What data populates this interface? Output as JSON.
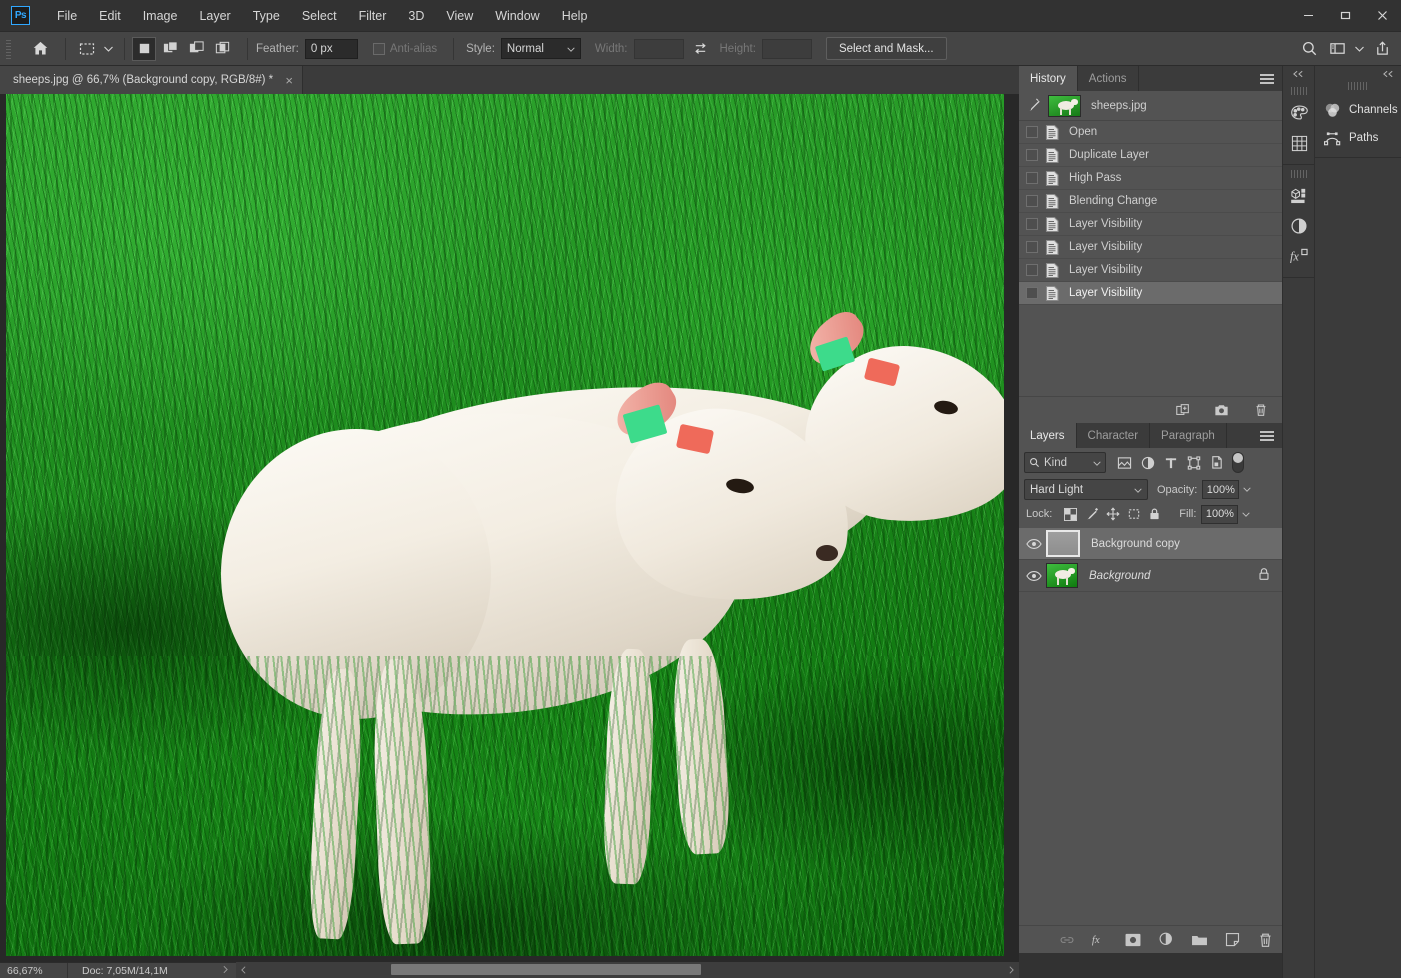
{
  "app": {
    "logo": "Ps",
    "menus": [
      "File",
      "Edit",
      "Image",
      "Layer",
      "Type",
      "Select",
      "Filter",
      "3D",
      "View",
      "Window",
      "Help"
    ],
    "window_controls": {
      "minimize": "minimize-icon",
      "maximize": "maximize-icon",
      "close": "close-icon"
    }
  },
  "options_bar": {
    "home_icon": "home-icon",
    "tool_icon": "rectangular-marquee-icon",
    "tool_caret": "chevron-down-icon",
    "selection_modes": [
      {
        "name": "new-selection",
        "active": true
      },
      {
        "name": "add-to-selection",
        "active": false
      },
      {
        "name": "subtract-from-selection",
        "active": false
      },
      {
        "name": "intersect-with-selection",
        "active": false
      }
    ],
    "feather_label": "Feather:",
    "feather_value": "0 px",
    "antialias_label": "Anti-alias",
    "antialias_checked": false,
    "style_label": "Style:",
    "style_value": "Normal",
    "width_label": "Width:",
    "width_value": "",
    "swap_icon": "swap-width-height-icon",
    "height_label": "Height:",
    "height_value": "",
    "select_and_mask": "Select and Mask...",
    "right_icons": [
      "search-icon",
      "workspace-icon",
      "chevron-down-icon",
      "share-icon"
    ]
  },
  "document": {
    "tab_title": "sheeps.jpg @ 66,7% (Background copy, RGB/8#) *",
    "close_icon": "close-icon"
  },
  "canvas": {
    "image_description": "two white lambs standing in bright green grass",
    "vscroll": {
      "up": "chevron-up-icon",
      "down": "chevron-down-icon"
    },
    "hscroll": {
      "left": "chevron-left-icon",
      "right": "chevron-right-icon"
    }
  },
  "status_bar": {
    "zoom": "66,67%",
    "doc_label": "Doc: 7,05M/14,1M",
    "expand_icon": "chevron-right-icon",
    "collapse_icon": "chevron-left-icon"
  },
  "history_panel": {
    "tabs": [
      {
        "label": "History",
        "active": true
      },
      {
        "label": "Actions",
        "active": false
      }
    ],
    "menu_icon": "panel-menu-icon",
    "snapshot": {
      "label": "sheeps.jpg",
      "brush_icon": "history-brush-icon"
    },
    "states": [
      {
        "label": "Open",
        "selected": false
      },
      {
        "label": "Duplicate Layer",
        "selected": false
      },
      {
        "label": "High Pass",
        "selected": false
      },
      {
        "label": "Blending Change",
        "selected": false
      },
      {
        "label": "Layer Visibility",
        "selected": false
      },
      {
        "label": "Layer Visibility",
        "selected": false
      },
      {
        "label": "Layer Visibility",
        "selected": false
      },
      {
        "label": "Layer Visibility",
        "selected": true
      }
    ],
    "footer_icons": [
      "create-document-from-state-icon",
      "create-snapshot-icon",
      "delete-state-icon"
    ]
  },
  "layers_panel": {
    "tabs": [
      {
        "label": "Layers",
        "active": true
      },
      {
        "label": "Character",
        "active": false
      },
      {
        "label": "Paragraph",
        "active": false
      }
    ],
    "menu_icon": "panel-menu-icon",
    "filter": {
      "kind_label": "Kind",
      "search_icon": "search-icon",
      "caret_icon": "chevron-down-icon",
      "type_filters": [
        "pixel-layer-filter-icon",
        "adjustment-layer-filter-icon",
        "type-layer-filter-icon",
        "shape-layer-filter-icon",
        "smart-object-filter-icon"
      ],
      "toggle_icon": "filter-toggle-switch"
    },
    "blend_mode": "Hard Light",
    "opacity_label": "Opacity:",
    "opacity_value": "100%",
    "lock_label": "Lock:",
    "lock_icons": [
      "lock-transparent-pixels-icon",
      "lock-image-pixels-icon",
      "lock-position-icon",
      "lock-artboard-nesting-icon",
      "lock-all-icon"
    ],
    "fill_label": "Fill:",
    "fill_value": "100%",
    "layers": [
      {
        "name": "Background copy",
        "visible": true,
        "selected": true,
        "italic": false,
        "locked": false,
        "thumb": "gray-highpass-thumb"
      },
      {
        "name": "Background",
        "visible": true,
        "selected": false,
        "italic": true,
        "locked": true,
        "thumb": "sheep-photo-thumb"
      }
    ],
    "footer_icons": [
      "link-layers-icon",
      "add-layer-style-icon",
      "add-layer-mask-icon",
      "new-adjustment-layer-icon",
      "new-group-icon",
      "new-layer-icon",
      "delete-layer-icon"
    ]
  },
  "icon_rail": {
    "collapse_icon": "double-chevron-left-icon",
    "groups": [
      [
        "color-swatches-icon",
        "swatches-grid-icon"
      ],
      [
        "3d-panel-icon",
        "adjustments-icon",
        "layer-styles-fx-icon"
      ]
    ]
  },
  "channels_paths_panel": {
    "collapse_icon": "double-chevron-left-icon",
    "items": [
      {
        "label": "Channels",
        "icon": "channels-icon"
      },
      {
        "label": "Paths",
        "icon": "paths-icon"
      }
    ]
  },
  "colors": {
    "app_bg": "#323232",
    "options_bar": "#454545",
    "panel_bg": "#535353",
    "tab_inactive": "#3b3b3b",
    "selection_highlight": "#6b6b6b",
    "text": "#d6d6d6",
    "accent_blue": "#31a8ff",
    "grass_green": "#1e8c1e",
    "wool_white": "#f3ede2"
  }
}
